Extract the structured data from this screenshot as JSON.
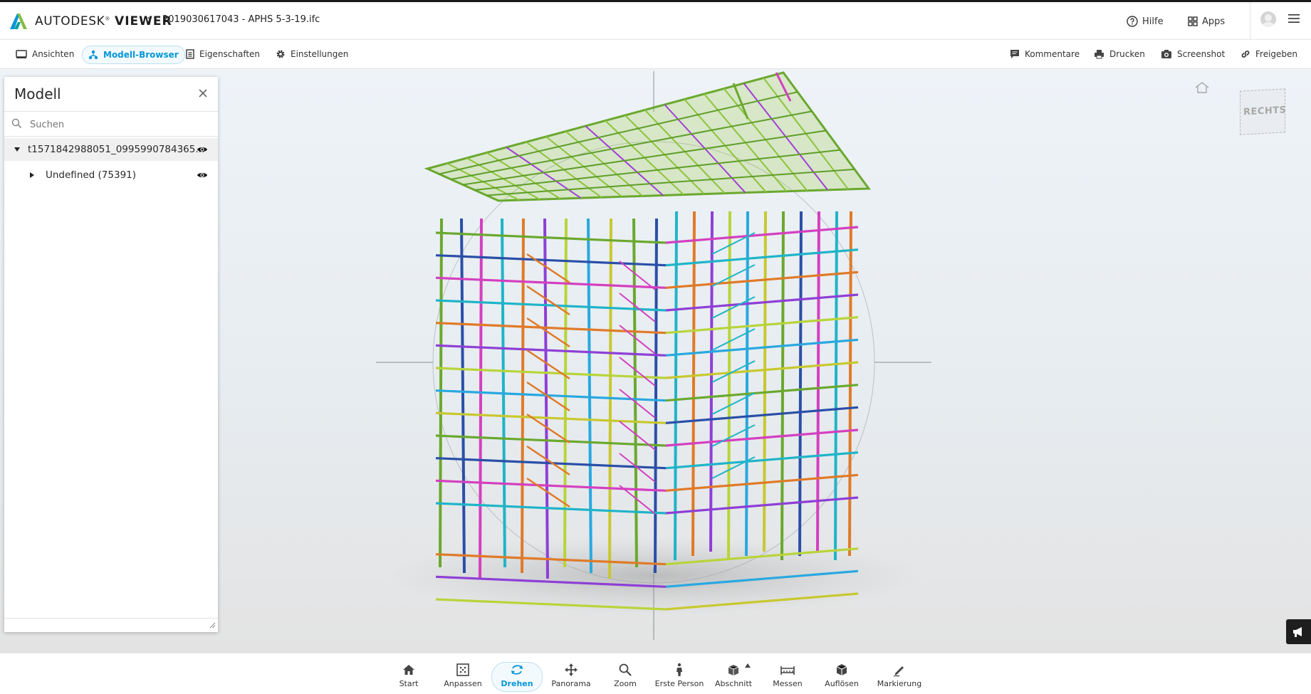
{
  "header": {
    "brand_prefix": "AUTODESK",
    "brand_suffix": "VIEWER",
    "filename": "2019030617043 - APHS 5-3-19.ifc",
    "help_label": "Hilfe",
    "apps_label": "Apps"
  },
  "toolbar": {
    "left": [
      {
        "label": "Ansichten",
        "icon": "views-icon"
      },
      {
        "label": "Modell-Browser",
        "icon": "model-browser-icon",
        "active": true
      },
      {
        "label": "Eigenschaften",
        "icon": "properties-icon"
      },
      {
        "label": "Einstellungen",
        "icon": "gear-icon"
      }
    ],
    "right": [
      {
        "label": "Kommentare",
        "icon": "comment-icon"
      },
      {
        "label": "Drucken",
        "icon": "print-icon"
      },
      {
        "label": "Screenshot",
        "icon": "camera-icon"
      },
      {
        "label": "Freigeben",
        "icon": "link-icon"
      }
    ]
  },
  "panel": {
    "title": "Modell",
    "search_placeholder": "Suchen",
    "tree": [
      {
        "label": "t1571842988051_0995990784365...",
        "expanded": true,
        "visible": true
      },
      {
        "label": "Undefined (75391)",
        "expanded": false,
        "visible": true
      }
    ]
  },
  "viewcube": {
    "face": "RECHTS"
  },
  "bottom_tools": [
    {
      "label": "Start",
      "icon": "home-icon"
    },
    {
      "label": "Anpassen",
      "icon": "fit-icon"
    },
    {
      "label": "Drehen",
      "icon": "orbit-icon",
      "active": true
    },
    {
      "label": "Panorama",
      "icon": "pan-icon"
    },
    {
      "label": "Zoom",
      "icon": "zoom-icon"
    },
    {
      "label": "Erste Person",
      "icon": "person-icon"
    },
    {
      "label": "Abschnitt",
      "icon": "section-icon"
    },
    {
      "label": "Messen",
      "icon": "measure-icon"
    },
    {
      "label": "Auflösen",
      "icon": "explode-icon"
    },
    {
      "label": "Markierung",
      "icon": "markup-icon"
    }
  ],
  "colors": {
    "accent": "#0696d7"
  }
}
